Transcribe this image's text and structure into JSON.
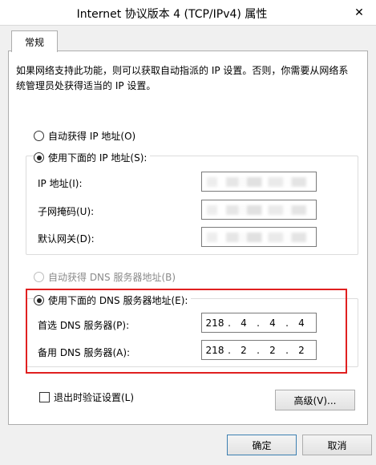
{
  "window": {
    "title": "Internet 协议版本 4 (TCP/IPv4) 属性",
    "close_glyph": "✕"
  },
  "tabs": [
    {
      "label": "常规",
      "active": true
    }
  ],
  "intro_text": "如果网络支持此功能，则可以获取自动指派的 IP 设置。否则，你需要从网络系统管理员处获得适当的 IP 设置。",
  "ip_section": {
    "auto_label": "自动获得 IP 地址(O)",
    "manual_label": "使用下面的 IP 地址(S):",
    "selected": "manual",
    "fields": [
      {
        "label": "IP 地址(I):",
        "value": ""
      },
      {
        "label": "子网掩码(U):",
        "value": ""
      },
      {
        "label": "默认网关(D):",
        "value": ""
      }
    ]
  },
  "dns_section": {
    "auto_label": "自动获得 DNS 服务器地址(B)",
    "auto_disabled": true,
    "manual_label": "使用下面的 DNS 服务器地址(E):",
    "selected": "manual",
    "preferred": {
      "label": "首选 DNS 服务器(P):",
      "octets": [
        "218",
        "4",
        "4",
        "4"
      ]
    },
    "alternate": {
      "label": "备用 DNS 服务器(A):",
      "octets": [
        "218",
        "2",
        "2",
        "2"
      ]
    }
  },
  "validate_on_exit": {
    "label": "退出时验证设置(L)",
    "checked": false
  },
  "buttons": {
    "advanced": "高级(V)...",
    "ok": "确定",
    "cancel": "取消"
  },
  "colors": {
    "highlight_border": "#e02020",
    "window_bg": "#f0f0f0",
    "panel_bg": "#ffffff"
  }
}
